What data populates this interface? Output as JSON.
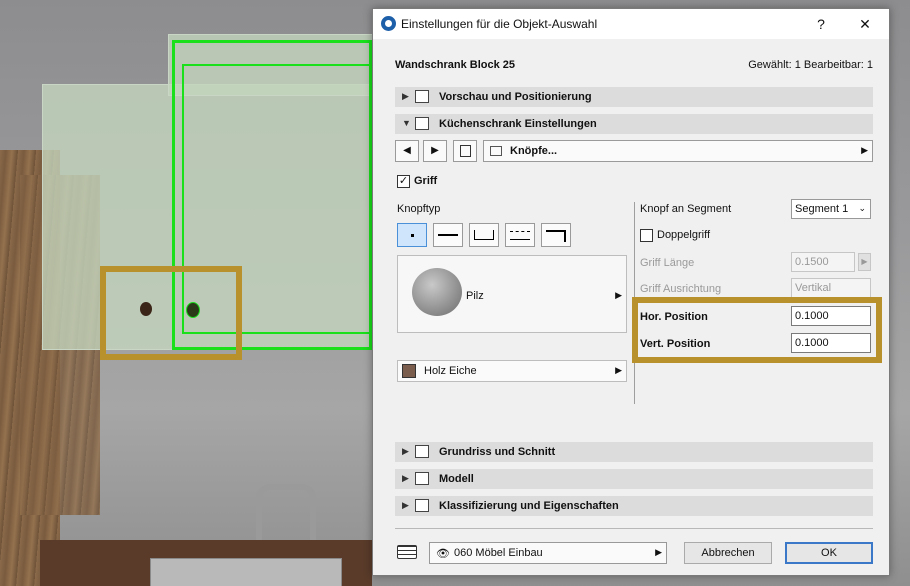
{
  "dialog": {
    "title": "Einstellungen für die Objekt-Auswahl",
    "help": "?",
    "close": "✕",
    "object_name": "Wandschrank Block 25",
    "selection_info": "Gewählt: 1 Bearbeitbar: 1"
  },
  "sections": {
    "preview": "Vorschau und Positionierung",
    "kitchen": "Küchenschrank Einstellungen",
    "floorplan": "Grundriss und Schnitt",
    "model": "Modell",
    "classification": "Klassifizierung und Eigenschaften"
  },
  "nav": {
    "prev": "◀",
    "next": "▶",
    "page_label": "Knöpfe..."
  },
  "params": {
    "griff_label": "Griff",
    "griff_checked": true,
    "knopftyp_label": "Knopftyp",
    "preview_label": "Pilz",
    "material_label": "Holz Eiche",
    "knopf_segment_label": "Knopf an Segment",
    "segment_value": "Segment 1",
    "doppelgriff_label": "Doppelgriff",
    "doppelgriff_checked": false,
    "griff_laenge_label": "Griff Länge",
    "griff_laenge_value": "0.1500",
    "griff_ausrichtung_label": "Griff Ausrichtung",
    "griff_ausrichtung_value": "Vertikal",
    "hor_pos_label": "Hor. Position",
    "hor_pos_value": "0.1000",
    "vert_pos_label": "Vert. Position",
    "vert_pos_value": "0.1000"
  },
  "footer": {
    "layer": "060 Möbel Einbau",
    "cancel": "Abbrechen",
    "ok": "OK"
  },
  "colors": {
    "highlight": "#b8912c",
    "selection_green": "#19e01a",
    "accent": "#3c78c8"
  }
}
